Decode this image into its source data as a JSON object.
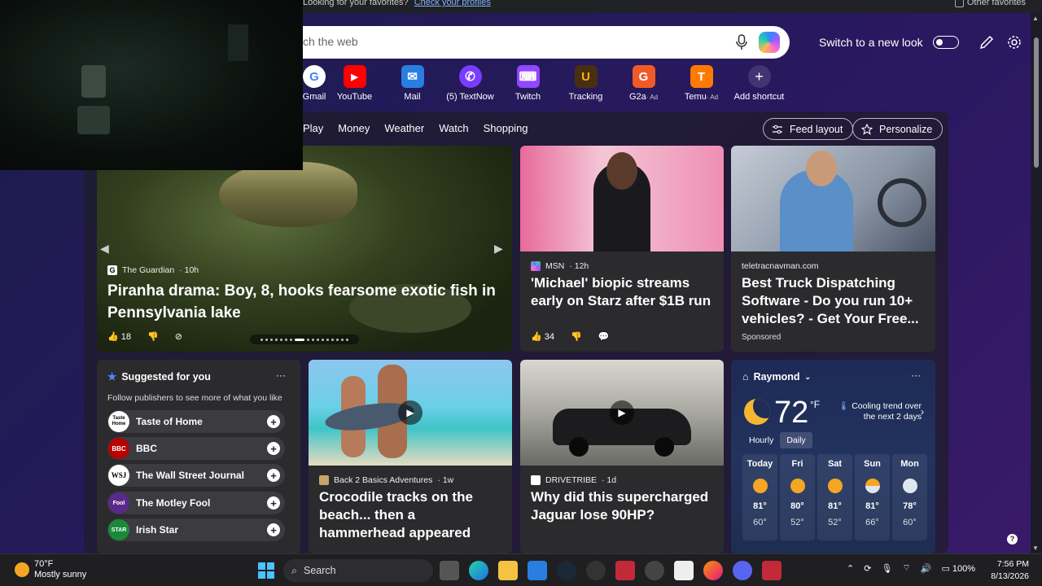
{
  "favorites_bar": {
    "message": "Looking for your favorites?",
    "link": "Check your profiles",
    "other": "Other favorites"
  },
  "search": {
    "placeholder": "Search the web",
    "visible_placeholder": "ch the web"
  },
  "top_controls": {
    "switch_label": "Switch to a new look"
  },
  "shortcuts": [
    {
      "label": "Gmail",
      "icon": "G",
      "color": "#fff",
      "ad": ""
    },
    {
      "label": "YouTube",
      "icon": "▶",
      "color": "#ff0000",
      "ad": ""
    },
    {
      "label": "Mail",
      "icon": "✉",
      "color": "#2a7de1",
      "ad": ""
    },
    {
      "label": "(5) TextNow",
      "icon": "✆",
      "color": "#7a3cff",
      "ad": ""
    },
    {
      "label": "Twitch",
      "icon": "⌨",
      "color": "#9146ff",
      "ad": ""
    },
    {
      "label": "Tracking",
      "icon": "U",
      "color": "#5a3a1a",
      "ad": ""
    },
    {
      "label": "G2a",
      "icon": "G",
      "color": "#f05a28",
      "ad": "· Ad"
    },
    {
      "label": "Temu",
      "icon": "T",
      "color": "#ff7a00",
      "ad": "· Ad"
    },
    {
      "label": "Add shortcut",
      "icon": "+",
      "color": "rgba(255,255,255,0.15)",
      "ad": ""
    }
  ],
  "nav": {
    "items": [
      "Play",
      "Money",
      "Weather",
      "Watch",
      "Shopping"
    ],
    "feed_layout": "Feed layout",
    "personalize": "Personalize"
  },
  "hero": {
    "source": "The Guardian",
    "age": "· 10h",
    "title": "Piranha drama: Boy, 8, hooks fearsome exotic fish in Pennsylvania lake",
    "likes": "18"
  },
  "card_msn": {
    "source": "MSN",
    "age": "· 12h",
    "title": "'Michael' biopic streams early on Starz after $1B run",
    "likes": "34"
  },
  "card_ad": {
    "source": "teletracnavman.com",
    "title": "Best Truck Dispatching Software - Do you run 10+ vehicles? - Get Your Free...",
    "sponsored": "Sponsored"
  },
  "suggested": {
    "title": "Suggested for you",
    "subtitle": "Follow publishers to see more of what you like",
    "publishers": [
      {
        "name": "Taste of Home",
        "logo": "Taste Home"
      },
      {
        "name": "BBC",
        "logo": "BBC"
      },
      {
        "name": "The Wall Street Journal",
        "logo": "WSJ"
      },
      {
        "name": "The Motley Fool",
        "logo": "Fool"
      },
      {
        "name": "Irish Star",
        "logo": "STAR"
      }
    ]
  },
  "card_croc": {
    "source": "Back 2 Basics Adventures",
    "age": "· 1w",
    "title": "Crocodile tracks on the beach... then a hammerhead appeared"
  },
  "card_jaguar": {
    "source": "DRIVETRIBE",
    "age": "· 1d",
    "title": "Why did this supercharged Jaguar lose 90HP?"
  },
  "weather": {
    "location": "Raymond",
    "temp": "72",
    "unit": "°F",
    "trend": "Cooling trend over the next 2 days",
    "tab_hourly": "Hourly",
    "tab_daily": "Daily",
    "days": [
      {
        "day": "Today",
        "hi": "81°",
        "lo": "60°",
        "icon": "sun"
      },
      {
        "day": "Fri",
        "hi": "80°",
        "lo": "52°",
        "icon": "sun"
      },
      {
        "day": "Sat",
        "hi": "81°",
        "lo": "52°",
        "icon": "sun"
      },
      {
        "day": "Sun",
        "hi": "81°",
        "lo": "66°",
        "icon": "partly-cloudy"
      },
      {
        "day": "Mon",
        "hi": "78°",
        "lo": "60°",
        "icon": "rain"
      }
    ]
  },
  "taskbar": {
    "weather_temp": "70°F",
    "weather_desc": "Mostly sunny",
    "search": "Search",
    "battery": "100%",
    "time": "7:56 PM",
    "date": "8/13/2026"
  }
}
